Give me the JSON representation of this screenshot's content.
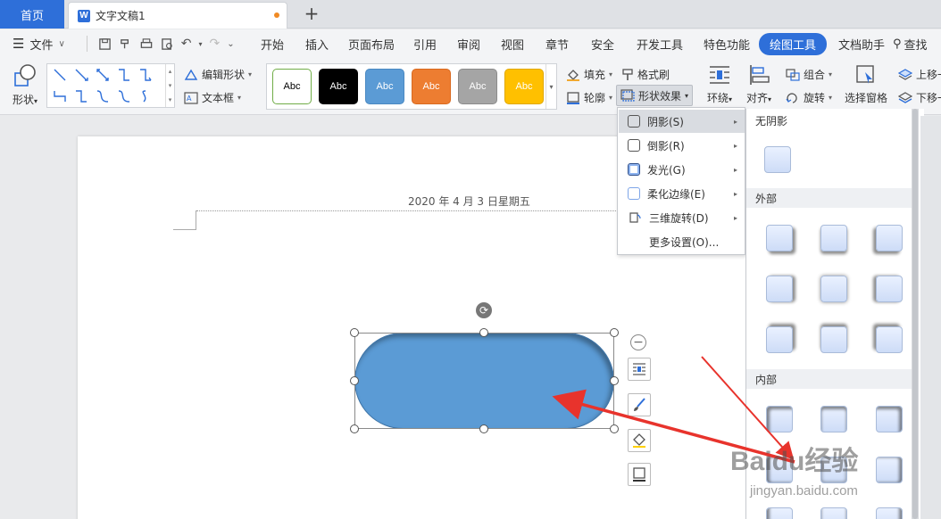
{
  "tabs": {
    "home": "首页",
    "doc_title": "文字文稿1",
    "doc_logo": "W",
    "new_tab": "+"
  },
  "menubar": {
    "file": "文件",
    "items": [
      "开始",
      "插入",
      "页面布局",
      "引用",
      "审阅",
      "视图",
      "章节",
      "安全",
      "开发工具",
      "特色功能",
      "绘图工具",
      "文档助手"
    ],
    "active": "绘图工具",
    "search": "查找"
  },
  "ribbon": {
    "shape": "形状",
    "edit_shape": "编辑形状",
    "text_box": "文本框",
    "style_label": "Abc",
    "styles": [
      {
        "bg": "#ffffff",
        "border": "#70ad47",
        "fg": "#000000"
      },
      {
        "bg": "#000000",
        "border": "#000000",
        "fg": "#ffffff"
      },
      {
        "bg": "#5b9bd5",
        "border": "#4a89c2",
        "fg": "#ffffff"
      },
      {
        "bg": "#ed7d31",
        "border": "#d96a20",
        "fg": "#ffffff"
      },
      {
        "bg": "#a5a5a5",
        "border": "#8c8c8c",
        "fg": "#ffffff"
      },
      {
        "bg": "#ffc000",
        "border": "#e0a800",
        "fg": "#ffffff"
      }
    ],
    "fill": "填充",
    "format_painter": "格式刷",
    "outline": "轮廓",
    "shape_effects": "形状效果",
    "wrap": "环绕",
    "align": "对齐",
    "group": "组合",
    "rotate": "旋转",
    "selection_pane": "选择窗格",
    "bring_forward": "上移一",
    "send_backward": "下移一"
  },
  "document": {
    "header_date": "2020 年 4 月 3 日星期五",
    "shape_color": "#5b9bd5"
  },
  "effects_menu": {
    "items": [
      {
        "label": "阴影(S)",
        "has_sub": true,
        "active": true
      },
      {
        "label": "倒影(R)",
        "has_sub": true
      },
      {
        "label": "发光(G)",
        "has_sub": true
      },
      {
        "label": "柔化边缘(E)",
        "has_sub": true
      },
      {
        "label": "三维旋转(D)",
        "has_sub": true
      },
      {
        "label": "更多设置(O)...",
        "has_sub": false
      }
    ]
  },
  "shadow_submenu": {
    "no_shadow": "无阴影",
    "outer": "外部",
    "inner": "内部"
  },
  "watermark": {
    "brand": "Baidu经验",
    "url": "jingyan.baidu.com"
  }
}
